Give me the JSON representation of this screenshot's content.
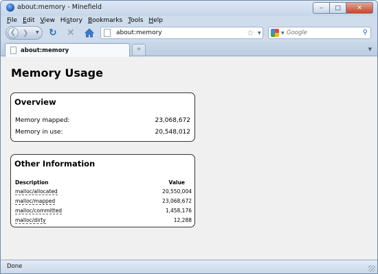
{
  "window": {
    "title": "about:memory - Minefield"
  },
  "menu": [
    {
      "label": "File",
      "hotkey": "F",
      "rest": "ile"
    },
    {
      "label": "Edit",
      "hotkey": "E",
      "rest": "dit"
    },
    {
      "label": "View",
      "hotkey": "V",
      "rest": "iew"
    },
    {
      "label": "History",
      "hotkey": "H",
      "rest": "istory"
    },
    {
      "label": "Bookmarks",
      "hotkey": "B",
      "rest": "ookmarks"
    },
    {
      "label": "Tools",
      "hotkey": "T",
      "rest": "ools"
    },
    {
      "label": "Help",
      "hotkey": "H",
      "rest": "elp"
    }
  ],
  "nav": {
    "url": "about:memory",
    "search_placeholder": "Google"
  },
  "tab": {
    "label": "about:memory"
  },
  "page": {
    "title": "Memory Usage",
    "overview": {
      "heading": "Overview",
      "rows": [
        {
          "label": "Memory mapped:",
          "value": "23,068,672"
        },
        {
          "label": "Memory in use:",
          "value": "20,548,012"
        }
      ]
    },
    "other": {
      "heading": "Other Information",
      "col_desc": "Description",
      "col_value": "Value",
      "rows": [
        {
          "desc": "malloc/allocated",
          "value": "20,550,004"
        },
        {
          "desc": "malloc/mapped",
          "value": "23,068,672"
        },
        {
          "desc": "malloc/committed",
          "value": "1,458,176"
        },
        {
          "desc": "malloc/dirty",
          "value": "12,288"
        }
      ]
    }
  },
  "status": {
    "text": "Done"
  }
}
